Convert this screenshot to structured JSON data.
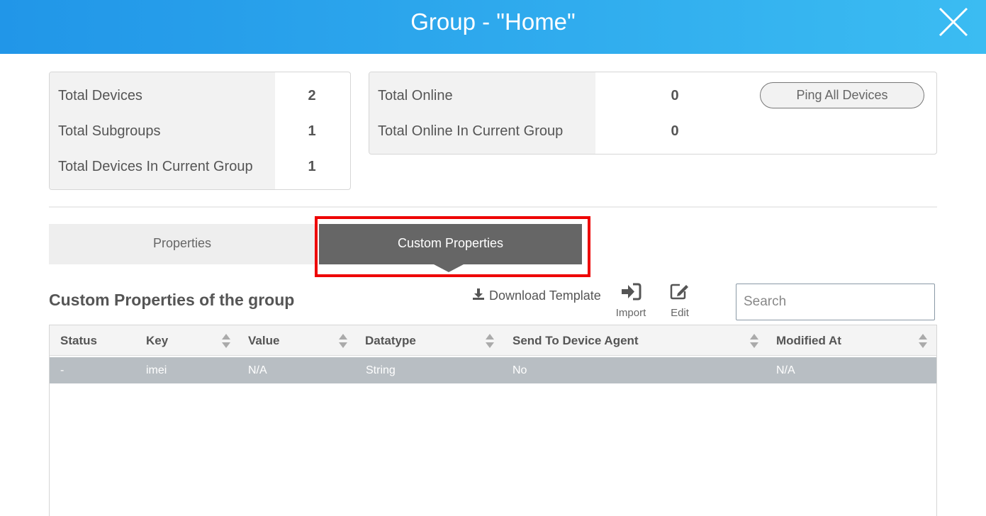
{
  "dialog": {
    "title": "Group - \"Home\"",
    "close_icon": "close-icon",
    "header_colors": [
      "#2196e8",
      "#3bbcf2"
    ]
  },
  "stats_left": {
    "rows": [
      {
        "label": "Total Devices",
        "value": "2"
      },
      {
        "label": "Total Subgroups",
        "value": "1"
      },
      {
        "label": "Total Devices In Current Group",
        "value": "1"
      }
    ]
  },
  "stats_right": {
    "rows": [
      {
        "label": "Total Online",
        "value": "0"
      },
      {
        "label": "Total Online In Current Group",
        "value": "0"
      }
    ],
    "ping_button": "Ping All Devices"
  },
  "tabs": [
    {
      "label": "Properties",
      "active": false
    },
    {
      "label": "Custom Properties",
      "active": true
    }
  ],
  "section": {
    "title": "Custom Properties of the group",
    "download_template": "Download Template",
    "download_icon": "download-icon",
    "import_label": "Import",
    "import_icon": "sign-in-icon",
    "edit_label": "Edit",
    "edit_icon": "edit-icon"
  },
  "search": {
    "placeholder": "Search",
    "value": ""
  },
  "table": {
    "columns": [
      "Status",
      "Key",
      "Value",
      "Datatype",
      "Send To Device Agent",
      "Modified At"
    ],
    "rows": [
      {
        "status": "-",
        "key": "imei",
        "value": "N/A",
        "datatype": "String",
        "send_to_agent": "No",
        "modified_at": "N/A"
      }
    ]
  },
  "accent_colors": {
    "highlight": "#ee0000",
    "active_tab": "#666666",
    "selected_row": "#b8bec3"
  }
}
